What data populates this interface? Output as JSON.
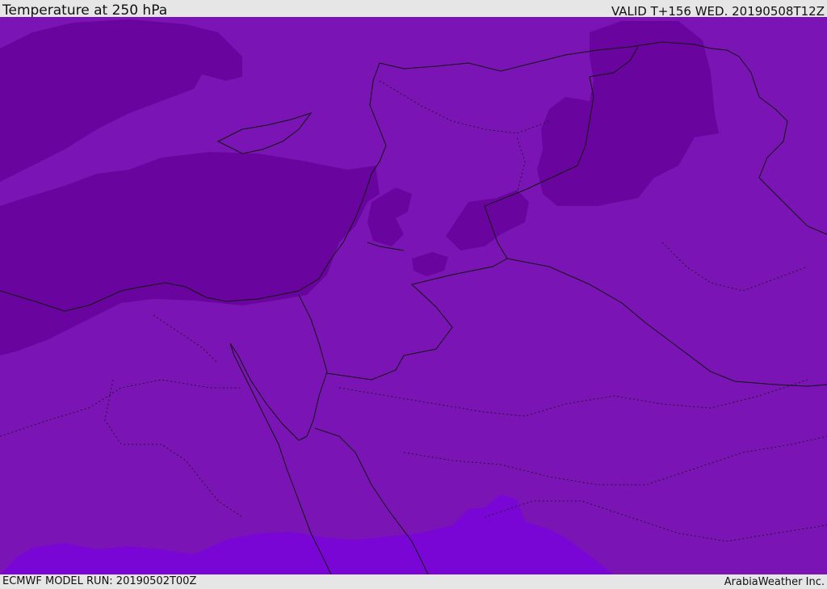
{
  "header": {
    "title": "Temperature at 250 hPa",
    "valid": "VALID T+156 WED. 20190508T12Z"
  },
  "footer": {
    "model_run": "ECMWF MODEL RUN: 20190502T00Z",
    "credit": "ArabiaWeather Inc."
  },
  "map": {
    "colors": {
      "base": "#7b14b4",
      "cold": "#6a049e",
      "warm": "#7a06d6",
      "border": "#111111"
    }
  }
}
